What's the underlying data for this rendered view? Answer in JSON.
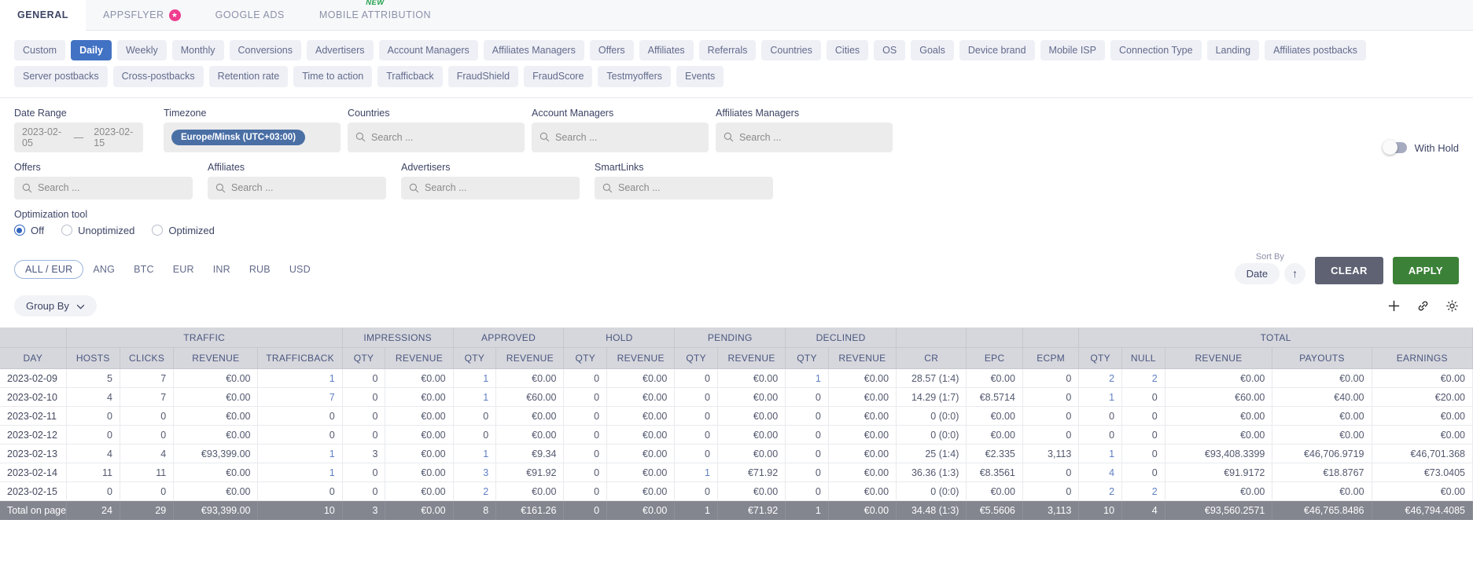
{
  "top_tabs": [
    {
      "label": "GENERAL",
      "active": true,
      "badge": null,
      "new": false
    },
    {
      "label": "APPSFLYER",
      "active": false,
      "badge": "star-icon",
      "new": false
    },
    {
      "label": "GOOGLE ADS",
      "active": false,
      "badge": null,
      "new": false
    },
    {
      "label": "MOBILE ATTRIBUTION",
      "active": false,
      "badge": null,
      "new": true
    }
  ],
  "new_flag": "NEW",
  "report_chips_row1": [
    {
      "label": "Custom",
      "active": false
    },
    {
      "label": "Daily",
      "active": true
    },
    {
      "label": "Weekly",
      "active": false
    },
    {
      "label": "Monthly",
      "active": false
    },
    {
      "label": "Conversions",
      "active": false
    },
    {
      "label": "Advertisers",
      "active": false
    },
    {
      "label": "Account Managers",
      "active": false
    },
    {
      "label": "Affiliates Managers",
      "active": false
    },
    {
      "label": "Offers",
      "active": false
    },
    {
      "label": "Affiliates",
      "active": false
    },
    {
      "label": "Referrals",
      "active": false
    },
    {
      "label": "Countries",
      "active": false
    },
    {
      "label": "Cities",
      "active": false
    },
    {
      "label": "OS",
      "active": false
    },
    {
      "label": "Goals",
      "active": false
    },
    {
      "label": "Device brand",
      "active": false
    },
    {
      "label": "Mobile ISP",
      "active": false
    },
    {
      "label": "Connection Type",
      "active": false
    },
    {
      "label": "Landing",
      "active": false
    },
    {
      "label": "Affiliates postbacks",
      "active": false
    }
  ],
  "report_chips_row2": [
    {
      "label": "Server postbacks",
      "active": false
    },
    {
      "label": "Cross-postbacks",
      "active": false
    },
    {
      "label": "Retention rate",
      "active": false
    },
    {
      "label": "Time to action",
      "active": false
    },
    {
      "label": "Trafficback",
      "active": false
    },
    {
      "label": "FraudShield",
      "active": false
    },
    {
      "label": "FraudScore",
      "active": false
    },
    {
      "label": "Testmyoffers",
      "active": false
    },
    {
      "label": "Events",
      "active": false
    }
  ],
  "filters": {
    "date_range": {
      "label": "Date Range",
      "from": "2023-02-05",
      "to": "2023-02-15",
      "separator": "—"
    },
    "timezone": {
      "label": "Timezone",
      "value": "Europe/Minsk (UTC+03:00)"
    },
    "countries": {
      "label": "Countries",
      "placeholder": "Search ..."
    },
    "account_managers": {
      "label": "Account Managers",
      "placeholder": "Search ..."
    },
    "affiliates_managers": {
      "label": "Affiliates Managers",
      "placeholder": "Search ..."
    },
    "offers": {
      "label": "Offers",
      "placeholder": "Search ..."
    },
    "affiliates": {
      "label": "Affiliates",
      "placeholder": "Search ..."
    },
    "advertisers": {
      "label": "Advertisers",
      "placeholder": "Search ..."
    },
    "smartlinks": {
      "label": "SmartLinks",
      "placeholder": "Search ..."
    },
    "with_hold": {
      "label": "With Hold",
      "on": false
    },
    "optimization": {
      "label": "Optimization tool",
      "options": [
        {
          "label": "Off",
          "selected": true
        },
        {
          "label": "Unoptimized",
          "selected": false
        },
        {
          "label": "Optimized",
          "selected": false
        }
      ]
    }
  },
  "currencies": [
    {
      "label": "ALL / EUR",
      "active": true
    },
    {
      "label": "ANG",
      "active": false
    },
    {
      "label": "BTC",
      "active": false
    },
    {
      "label": "EUR",
      "active": false
    },
    {
      "label": "INR",
      "active": false
    },
    {
      "label": "RUB",
      "active": false
    },
    {
      "label": "USD",
      "active": false
    }
  ],
  "sort": {
    "label": "Sort By",
    "value": "Date",
    "direction": "↑"
  },
  "buttons": {
    "clear": "CLEAR",
    "apply": "APPLY"
  },
  "group_by": {
    "label": "Group By"
  },
  "table": {
    "group_headers": [
      {
        "label": "",
        "span": 1
      },
      {
        "label": "TRAFFIC",
        "span": 4
      },
      {
        "label": "IMPRESSIONS",
        "span": 2
      },
      {
        "label": "APPROVED",
        "span": 2
      },
      {
        "label": "HOLD",
        "span": 2
      },
      {
        "label": "PENDING",
        "span": 2
      },
      {
        "label": "DECLINED",
        "span": 2
      },
      {
        "label": "",
        "span": 1
      },
      {
        "label": "",
        "span": 1
      },
      {
        "label": "",
        "span": 1
      },
      {
        "label": "TOTAL",
        "span": 5
      }
    ],
    "columns": [
      "DAY",
      "HOSTS",
      "CLICKS",
      "REVENUE",
      "TRAFFICBACK",
      "QTY",
      "REVENUE",
      "QTY",
      "REVENUE",
      "QTY",
      "REVENUE",
      "QTY",
      "REVENUE",
      "QTY",
      "REVENUE",
      "CR",
      "EPC",
      "ECPM",
      "QTY",
      "NULL",
      "REVENUE",
      "PAYOUTS",
      "EARNINGS"
    ],
    "rows": [
      {
        "cells": [
          "2023-02-09",
          "5",
          "7",
          "€0.00",
          "1",
          "0",
          "€0.00",
          "1",
          "€0.00",
          "0",
          "€0.00",
          "0",
          "€0.00",
          "1",
          "€0.00",
          "28.57 (1:4)",
          "€0.00",
          "0",
          "2",
          "2",
          "€0.00",
          "€0.00",
          "€0.00"
        ],
        "links": [
          4,
          7,
          13,
          18,
          19
        ]
      },
      {
        "cells": [
          "2023-02-10",
          "4",
          "7",
          "€0.00",
          "7",
          "0",
          "€0.00",
          "1",
          "€60.00",
          "0",
          "€0.00",
          "0",
          "€0.00",
          "0",
          "€0.00",
          "14.29 (1:7)",
          "€8.5714",
          "0",
          "1",
          "0",
          "€60.00",
          "€40.00",
          "€20.00"
        ],
        "links": [
          4,
          7,
          18
        ]
      },
      {
        "cells": [
          "2023-02-11",
          "0",
          "0",
          "€0.00",
          "0",
          "0",
          "€0.00",
          "0",
          "€0.00",
          "0",
          "€0.00",
          "0",
          "€0.00",
          "0",
          "€0.00",
          "0 (0:0)",
          "€0.00",
          "0",
          "0",
          "0",
          "€0.00",
          "€0.00",
          "€0.00"
        ],
        "links": []
      },
      {
        "cells": [
          "2023-02-12",
          "0",
          "0",
          "€0.00",
          "0",
          "0",
          "€0.00",
          "0",
          "€0.00",
          "0",
          "€0.00",
          "0",
          "€0.00",
          "0",
          "€0.00",
          "0 (0:0)",
          "€0.00",
          "0",
          "0",
          "0",
          "€0.00",
          "€0.00",
          "€0.00"
        ],
        "links": []
      },
      {
        "cells": [
          "2023-02-13",
          "4",
          "4",
          "€93,399.00",
          "1",
          "3",
          "€0.00",
          "1",
          "€9.34",
          "0",
          "€0.00",
          "0",
          "€0.00",
          "0",
          "€0.00",
          "25 (1:4)",
          "€2.335",
          "3,113",
          "1",
          "0",
          "€93,408.3399",
          "€46,706.9719",
          "€46,701.368"
        ],
        "links": [
          4,
          7,
          18
        ]
      },
      {
        "cells": [
          "2023-02-14",
          "11",
          "11",
          "€0.00",
          "1",
          "0",
          "€0.00",
          "3",
          "€91.92",
          "0",
          "€0.00",
          "1",
          "€71.92",
          "0",
          "€0.00",
          "36.36 (1:3)",
          "€8.3561",
          "0",
          "4",
          "0",
          "€91.9172",
          "€18.8767",
          "€73.0405"
        ],
        "links": [
          4,
          7,
          11,
          18
        ]
      },
      {
        "cells": [
          "2023-02-15",
          "0",
          "0",
          "€0.00",
          "0",
          "0",
          "€0.00",
          "2",
          "€0.00",
          "0",
          "€0.00",
          "0",
          "€0.00",
          "0",
          "€0.00",
          "0 (0:0)",
          "€0.00",
          "0",
          "2",
          "2",
          "€0.00",
          "€0.00",
          "€0.00"
        ],
        "links": [
          7,
          18,
          19
        ]
      }
    ],
    "total_row": {
      "cells": [
        "Total on page",
        "24",
        "29",
        "€93,399.00",
        "10",
        "3",
        "€0.00",
        "8",
        "€161.26",
        "0",
        "€0.00",
        "1",
        "€71.92",
        "1",
        "€0.00",
        "34.48 (1:3)",
        "€5.5606",
        "3,113",
        "10",
        "4",
        "€93,560.2571",
        "€46,765.8486",
        "€46,794.4085"
      ]
    }
  },
  "colors": {
    "accent_blue": "#4272c4",
    "apply_green": "#3c8138",
    "clear_gray": "#5e6273",
    "badge_pink": "#ef3b8e",
    "new_green": "#23a24d",
    "link_blue": "#5f7fc4"
  }
}
